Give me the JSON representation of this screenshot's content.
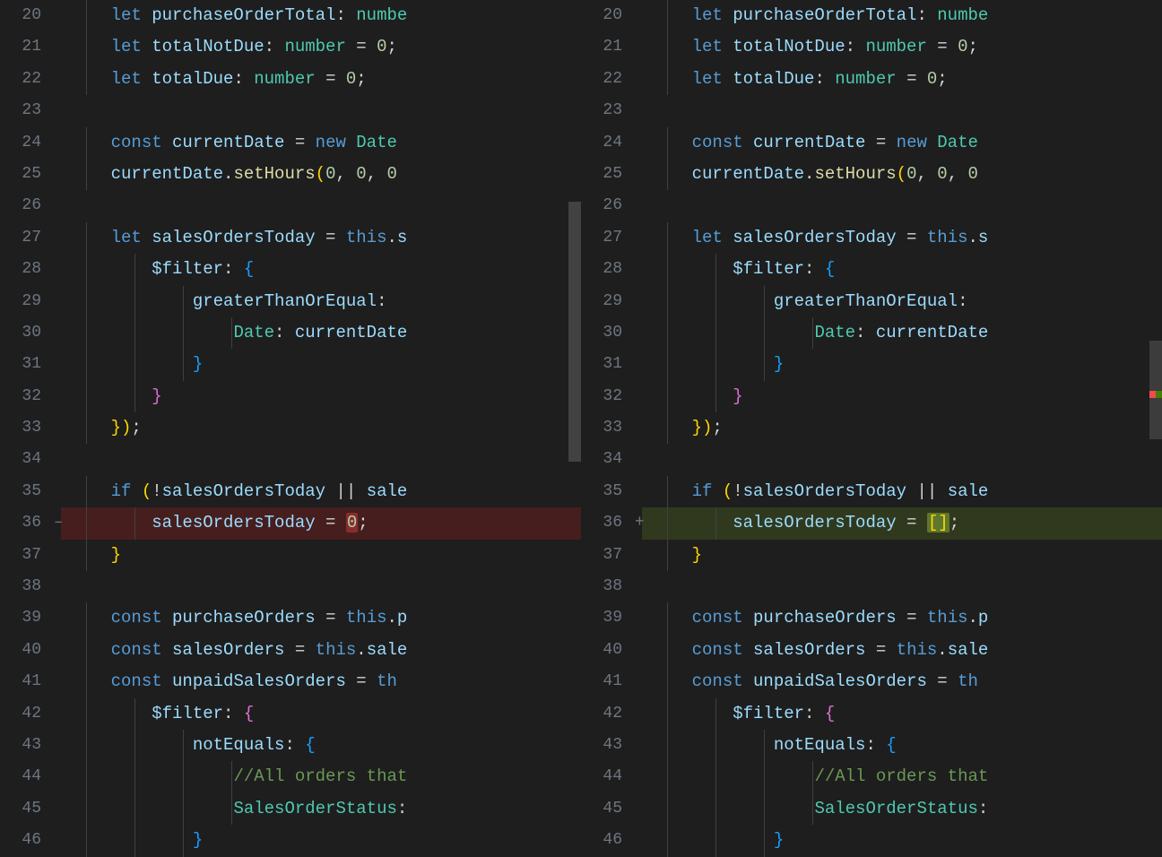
{
  "left": {
    "startLine": 20,
    "diffIndicator": "–",
    "lines": [
      {
        "n": 20,
        "kind": "",
        "tokens": [
          [
            "    ",
            ""
          ],
          [
            "let ",
            "kw"
          ],
          [
            "purchaseOrderTotal",
            "id"
          ],
          [
            ": ",
            "pun"
          ],
          [
            "numbe",
            "typ"
          ]
        ]
      },
      {
        "n": 21,
        "kind": "",
        "tokens": [
          [
            "    ",
            ""
          ],
          [
            "let ",
            "kw"
          ],
          [
            "totalNotDue",
            "id"
          ],
          [
            ": ",
            "pun"
          ],
          [
            "number",
            "typ"
          ],
          [
            " = ",
            "op"
          ],
          [
            "0",
            "num"
          ],
          [
            ";",
            "pun"
          ]
        ]
      },
      {
        "n": 22,
        "kind": "",
        "tokens": [
          [
            "    ",
            ""
          ],
          [
            "let ",
            "kw"
          ],
          [
            "totalDue",
            "id"
          ],
          [
            ": ",
            "pun"
          ],
          [
            "number",
            "typ"
          ],
          [
            " = ",
            "op"
          ],
          [
            "0",
            "num"
          ],
          [
            ";",
            "pun"
          ]
        ]
      },
      {
        "n": 23,
        "kind": "",
        "tokens": [
          [
            "",
            ""
          ]
        ]
      },
      {
        "n": 24,
        "kind": "",
        "tokens": [
          [
            "    ",
            ""
          ],
          [
            "const ",
            "kw"
          ],
          [
            "currentDate",
            "id"
          ],
          [
            " = ",
            "op"
          ],
          [
            "new ",
            "kw"
          ],
          [
            "Date",
            "typ"
          ]
        ]
      },
      {
        "n": 25,
        "kind": "",
        "tokens": [
          [
            "    ",
            ""
          ],
          [
            "currentDate",
            "id"
          ],
          [
            ".",
            "pun"
          ],
          [
            "setHours",
            "fn"
          ],
          [
            "(",
            "brace-y"
          ],
          [
            "0",
            "num"
          ],
          [
            ", ",
            "pun"
          ],
          [
            "0",
            "num"
          ],
          [
            ", ",
            "pun"
          ],
          [
            "0",
            "num"
          ]
        ]
      },
      {
        "n": 26,
        "kind": "",
        "tokens": [
          [
            "",
            ""
          ]
        ]
      },
      {
        "n": 27,
        "kind": "",
        "tokens": [
          [
            "    ",
            ""
          ],
          [
            "let ",
            "kw"
          ],
          [
            "salesOrdersToday",
            "id"
          ],
          [
            " = ",
            "op"
          ],
          [
            "this",
            "kw"
          ],
          [
            ".",
            "pun"
          ],
          [
            "s",
            "id"
          ]
        ]
      },
      {
        "n": 28,
        "kind": "",
        "tokens": [
          [
            "        ",
            ""
          ],
          [
            "$filter",
            "id"
          ],
          [
            ": ",
            "pun"
          ],
          [
            "{",
            "brace-b"
          ]
        ]
      },
      {
        "n": 29,
        "kind": "",
        "tokens": [
          [
            "            ",
            ""
          ],
          [
            "greaterThanOrEqual",
            "id"
          ],
          [
            ": ",
            "pun"
          ]
        ]
      },
      {
        "n": 30,
        "kind": "",
        "tokens": [
          [
            "                ",
            ""
          ],
          [
            "Date",
            "typ"
          ],
          [
            ": ",
            "pun"
          ],
          [
            "currentDate",
            "id"
          ]
        ]
      },
      {
        "n": 31,
        "kind": "",
        "tokens": [
          [
            "            ",
            ""
          ],
          [
            "}",
            "brace-b"
          ]
        ]
      },
      {
        "n": 32,
        "kind": "",
        "tokens": [
          [
            "        ",
            ""
          ],
          [
            "}",
            "brace-m"
          ]
        ]
      },
      {
        "n": 33,
        "kind": "",
        "tokens": [
          [
            "    ",
            ""
          ],
          [
            "}",
            "brace-y"
          ],
          [
            ")",
            "brace-y"
          ],
          [
            ";",
            "pun"
          ]
        ]
      },
      {
        "n": 34,
        "kind": "",
        "tokens": [
          [
            "",
            ""
          ]
        ]
      },
      {
        "n": 35,
        "kind": "",
        "tokens": [
          [
            "    ",
            ""
          ],
          [
            "if ",
            "kw"
          ],
          [
            "(",
            "brace-y"
          ],
          [
            "!",
            "op"
          ],
          [
            "salesOrdersToday",
            "id"
          ],
          [
            " || ",
            "op"
          ],
          [
            "sale",
            "id"
          ]
        ]
      },
      {
        "n": 36,
        "kind": "remove",
        "tokens": [
          [
            "        ",
            ""
          ],
          [
            "salesOrdersToday",
            "id"
          ],
          [
            " = ",
            "op"
          ],
          [
            "0",
            "num diff-char-remove"
          ],
          [
            ";",
            "pun"
          ]
        ]
      },
      {
        "n": 37,
        "kind": "",
        "tokens": [
          [
            "    ",
            ""
          ],
          [
            "}",
            "brace-y"
          ]
        ]
      },
      {
        "n": 38,
        "kind": "",
        "tokens": [
          [
            "",
            ""
          ]
        ]
      },
      {
        "n": 39,
        "kind": "",
        "tokens": [
          [
            "    ",
            ""
          ],
          [
            "const ",
            "kw"
          ],
          [
            "purchaseOrders",
            "id"
          ],
          [
            " = ",
            "op"
          ],
          [
            "this",
            "kw"
          ],
          [
            ".",
            "pun"
          ],
          [
            "p",
            "id"
          ]
        ]
      },
      {
        "n": 40,
        "kind": "",
        "tokens": [
          [
            "    ",
            ""
          ],
          [
            "const ",
            "kw"
          ],
          [
            "salesOrders",
            "id"
          ],
          [
            " = ",
            "op"
          ],
          [
            "this",
            "kw"
          ],
          [
            ".",
            "pun"
          ],
          [
            "sale",
            "id"
          ]
        ]
      },
      {
        "n": 41,
        "kind": "",
        "tokens": [
          [
            "    ",
            ""
          ],
          [
            "const ",
            "kw"
          ],
          [
            "unpaidSalesOrders",
            "id"
          ],
          [
            " = ",
            "op"
          ],
          [
            "th",
            "kw"
          ]
        ]
      },
      {
        "n": 42,
        "kind": "",
        "tokens": [
          [
            "        ",
            ""
          ],
          [
            "$filter",
            "id"
          ],
          [
            ": ",
            "pun"
          ],
          [
            "{",
            "brace-m"
          ]
        ]
      },
      {
        "n": 43,
        "kind": "",
        "tokens": [
          [
            "            ",
            ""
          ],
          [
            "notEquals",
            "id"
          ],
          [
            ": ",
            "pun"
          ],
          [
            "{",
            "brace-b"
          ]
        ]
      },
      {
        "n": 44,
        "kind": "",
        "tokens": [
          [
            "                ",
            ""
          ],
          [
            "//All orders that",
            "cmt"
          ]
        ]
      },
      {
        "n": 45,
        "kind": "",
        "tokens": [
          [
            "                ",
            ""
          ],
          [
            "SalesOrderStatus",
            "typ"
          ],
          [
            ":",
            "pun"
          ]
        ]
      },
      {
        "n": 46,
        "kind": "",
        "tokens": [
          [
            "            ",
            ""
          ],
          [
            "}",
            "brace-b"
          ]
        ]
      }
    ]
  },
  "right": {
    "startLine": 20,
    "diffIndicator": "+",
    "lines": [
      {
        "n": 20,
        "kind": "",
        "tokens": [
          [
            "    ",
            ""
          ],
          [
            "let ",
            "kw"
          ],
          [
            "purchaseOrderTotal",
            "id"
          ],
          [
            ": ",
            "pun"
          ],
          [
            "numbe",
            "typ"
          ]
        ]
      },
      {
        "n": 21,
        "kind": "",
        "tokens": [
          [
            "    ",
            ""
          ],
          [
            "let ",
            "kw"
          ],
          [
            "totalNotDue",
            "id"
          ],
          [
            ": ",
            "pun"
          ],
          [
            "number",
            "typ"
          ],
          [
            " = ",
            "op"
          ],
          [
            "0",
            "num"
          ],
          [
            ";",
            "pun"
          ]
        ]
      },
      {
        "n": 22,
        "kind": "",
        "tokens": [
          [
            "    ",
            ""
          ],
          [
            "let ",
            "kw"
          ],
          [
            "totalDue",
            "id"
          ],
          [
            ": ",
            "pun"
          ],
          [
            "number",
            "typ"
          ],
          [
            " = ",
            "op"
          ],
          [
            "0",
            "num"
          ],
          [
            ";",
            "pun"
          ]
        ]
      },
      {
        "n": 23,
        "kind": "",
        "tokens": [
          [
            "",
            ""
          ]
        ]
      },
      {
        "n": 24,
        "kind": "",
        "tokens": [
          [
            "    ",
            ""
          ],
          [
            "const ",
            "kw"
          ],
          [
            "currentDate",
            "id"
          ],
          [
            " = ",
            "op"
          ],
          [
            "new ",
            "kw"
          ],
          [
            "Date",
            "typ"
          ]
        ]
      },
      {
        "n": 25,
        "kind": "",
        "tokens": [
          [
            "    ",
            ""
          ],
          [
            "currentDate",
            "id"
          ],
          [
            ".",
            "pun"
          ],
          [
            "setHours",
            "fn"
          ],
          [
            "(",
            "brace-y"
          ],
          [
            "0",
            "num"
          ],
          [
            ", ",
            "pun"
          ],
          [
            "0",
            "num"
          ],
          [
            ", ",
            "pun"
          ],
          [
            "0",
            "num"
          ]
        ]
      },
      {
        "n": 26,
        "kind": "",
        "tokens": [
          [
            "",
            ""
          ]
        ]
      },
      {
        "n": 27,
        "kind": "",
        "tokens": [
          [
            "    ",
            ""
          ],
          [
            "let ",
            "kw"
          ],
          [
            "salesOrdersToday",
            "id"
          ],
          [
            " = ",
            "op"
          ],
          [
            "this",
            "kw"
          ],
          [
            ".",
            "pun"
          ],
          [
            "s",
            "id"
          ]
        ]
      },
      {
        "n": 28,
        "kind": "",
        "tokens": [
          [
            "        ",
            ""
          ],
          [
            "$filter",
            "id"
          ],
          [
            ": ",
            "pun"
          ],
          [
            "{",
            "brace-b"
          ]
        ]
      },
      {
        "n": 29,
        "kind": "",
        "tokens": [
          [
            "            ",
            ""
          ],
          [
            "greaterThanOrEqual",
            "id"
          ],
          [
            ": ",
            "pun"
          ]
        ]
      },
      {
        "n": 30,
        "kind": "",
        "tokens": [
          [
            "                ",
            ""
          ],
          [
            "Date",
            "typ"
          ],
          [
            ": ",
            "pun"
          ],
          [
            "currentDate",
            "id"
          ]
        ]
      },
      {
        "n": 31,
        "kind": "",
        "tokens": [
          [
            "            ",
            ""
          ],
          [
            "}",
            "brace-b"
          ]
        ]
      },
      {
        "n": 32,
        "kind": "",
        "tokens": [
          [
            "        ",
            ""
          ],
          [
            "}",
            "brace-m"
          ]
        ]
      },
      {
        "n": 33,
        "kind": "",
        "tokens": [
          [
            "    ",
            ""
          ],
          [
            "}",
            "brace-y"
          ],
          [
            ")",
            "brace-y"
          ],
          [
            ";",
            "pun"
          ]
        ]
      },
      {
        "n": 34,
        "kind": "",
        "tokens": [
          [
            "",
            ""
          ]
        ]
      },
      {
        "n": 35,
        "kind": "",
        "tokens": [
          [
            "    ",
            ""
          ],
          [
            "if ",
            "kw"
          ],
          [
            "(",
            "brace-y"
          ],
          [
            "!",
            "op"
          ],
          [
            "salesOrdersToday",
            "id"
          ],
          [
            " || ",
            "op"
          ],
          [
            "sale",
            "id"
          ]
        ]
      },
      {
        "n": 36,
        "kind": "add",
        "tokens": [
          [
            "        ",
            ""
          ],
          [
            "salesOrdersToday",
            "id"
          ],
          [
            " = ",
            "op"
          ],
          [
            "[]",
            "brace-y diff-char-add"
          ],
          [
            ";",
            "pun"
          ]
        ]
      },
      {
        "n": 37,
        "kind": "",
        "tokens": [
          [
            "    ",
            ""
          ],
          [
            "}",
            "brace-y"
          ]
        ]
      },
      {
        "n": 38,
        "kind": "",
        "tokens": [
          [
            "",
            ""
          ]
        ]
      },
      {
        "n": 39,
        "kind": "",
        "tokens": [
          [
            "    ",
            ""
          ],
          [
            "const ",
            "kw"
          ],
          [
            "purchaseOrders",
            "id"
          ],
          [
            " = ",
            "op"
          ],
          [
            "this",
            "kw"
          ],
          [
            ".",
            "pun"
          ],
          [
            "p",
            "id"
          ]
        ]
      },
      {
        "n": 40,
        "kind": "",
        "tokens": [
          [
            "    ",
            ""
          ],
          [
            "const ",
            "kw"
          ],
          [
            "salesOrders",
            "id"
          ],
          [
            " = ",
            "op"
          ],
          [
            "this",
            "kw"
          ],
          [
            ".",
            "pun"
          ],
          [
            "sale",
            "id"
          ]
        ]
      },
      {
        "n": 41,
        "kind": "",
        "tokens": [
          [
            "    ",
            ""
          ],
          [
            "const ",
            "kw"
          ],
          [
            "unpaidSalesOrders",
            "id"
          ],
          [
            " = ",
            "op"
          ],
          [
            "th",
            "kw"
          ]
        ]
      },
      {
        "n": 42,
        "kind": "",
        "tokens": [
          [
            "        ",
            ""
          ],
          [
            "$filter",
            "id"
          ],
          [
            ": ",
            "pun"
          ],
          [
            "{",
            "brace-m"
          ]
        ]
      },
      {
        "n": 43,
        "kind": "",
        "tokens": [
          [
            "            ",
            ""
          ],
          [
            "notEquals",
            "id"
          ],
          [
            ": ",
            "pun"
          ],
          [
            "{",
            "brace-b"
          ]
        ]
      },
      {
        "n": 44,
        "kind": "",
        "tokens": [
          [
            "                ",
            ""
          ],
          [
            "//All orders that",
            "cmt"
          ]
        ]
      },
      {
        "n": 45,
        "kind": "",
        "tokens": [
          [
            "                ",
            ""
          ],
          [
            "SalesOrderStatus",
            "typ"
          ],
          [
            ":",
            "pun"
          ]
        ]
      },
      {
        "n": 46,
        "kind": "",
        "tokens": [
          [
            "            ",
            ""
          ],
          [
            "}",
            "brace-b"
          ]
        ]
      }
    ]
  },
  "indentGuideOffsets": [
    96,
    150,
    204,
    258
  ],
  "scroll": {
    "leftThumbTop": 225,
    "leftThumbHeight": 290,
    "ovScrollTop": 380,
    "ovScrollHeight": 110,
    "ovMarkTop": 436
  }
}
